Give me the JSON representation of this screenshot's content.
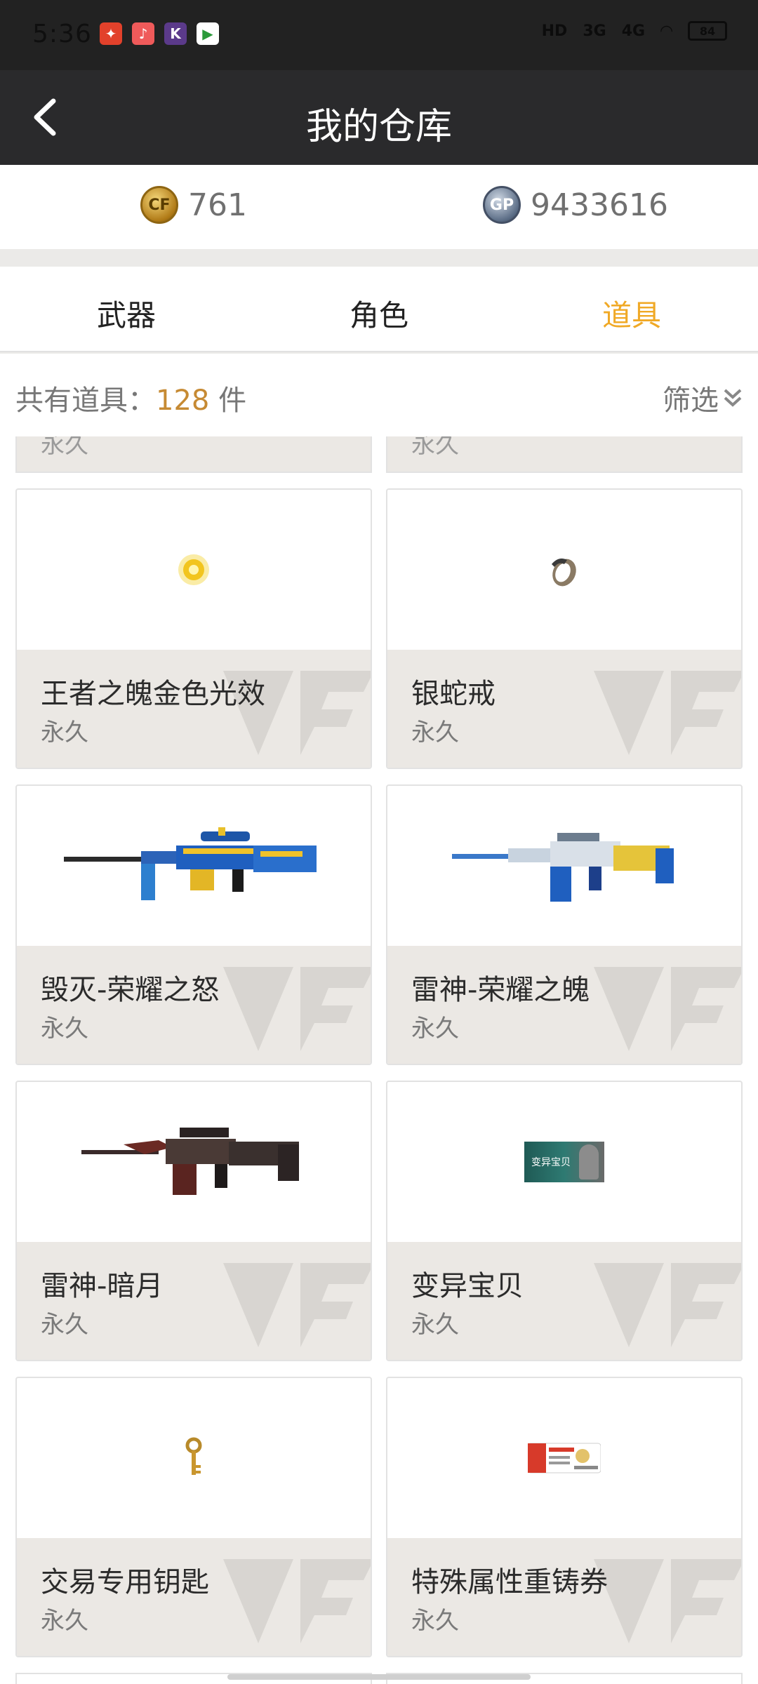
{
  "status": {
    "time": "5:36",
    "network": "HD",
    "signal_3g": "3G",
    "signal_4g": "4G",
    "battery": "84"
  },
  "nav": {
    "title": "我的仓库"
  },
  "currency": {
    "cf_amount": "761",
    "gp_amount": "9433616",
    "cf_icon_text": "CF",
    "gp_icon_text": "GP"
  },
  "tabs": [
    {
      "label": "武器",
      "active": false
    },
    {
      "label": "角色",
      "active": false
    },
    {
      "label": "道具",
      "active": true
    }
  ],
  "summary": {
    "prefix": "共有道具：",
    "count": "128",
    "suffix": " 件",
    "filter_label": "筛选"
  },
  "partial_top": [
    {
      "duration": "永久"
    },
    {
      "duration": "永久"
    }
  ],
  "items": [
    {
      "name": "王者之魄金色光效",
      "duration": "永久",
      "icon": "gold-glow-icon"
    },
    {
      "name": "银蛇戒",
      "duration": "永久",
      "icon": "silver-snake-ring-icon"
    },
    {
      "name": "毁灭-荣耀之怒",
      "duration": "永久",
      "icon": "sniper-rifle-icon"
    },
    {
      "name": "雷神-荣耀之魄",
      "duration": "永久",
      "icon": "assault-rifle-blue-icon"
    },
    {
      "name": "雷神-暗月",
      "duration": "永久",
      "icon": "assault-rifle-dark-icon"
    },
    {
      "name": "变异宝贝",
      "duration": "永久",
      "icon": "mutant-card-icon"
    },
    {
      "name": "交易专用钥匙",
      "duration": "永久",
      "icon": "key-icon"
    },
    {
      "name": "特殊属性重铸券",
      "duration": "永久",
      "icon": "ticket-icon"
    }
  ],
  "mutant_card_text": "变异宝贝",
  "colors": {
    "accent": "#f0a926",
    "count": "#c68a33",
    "header": "#2a2a2c"
  }
}
